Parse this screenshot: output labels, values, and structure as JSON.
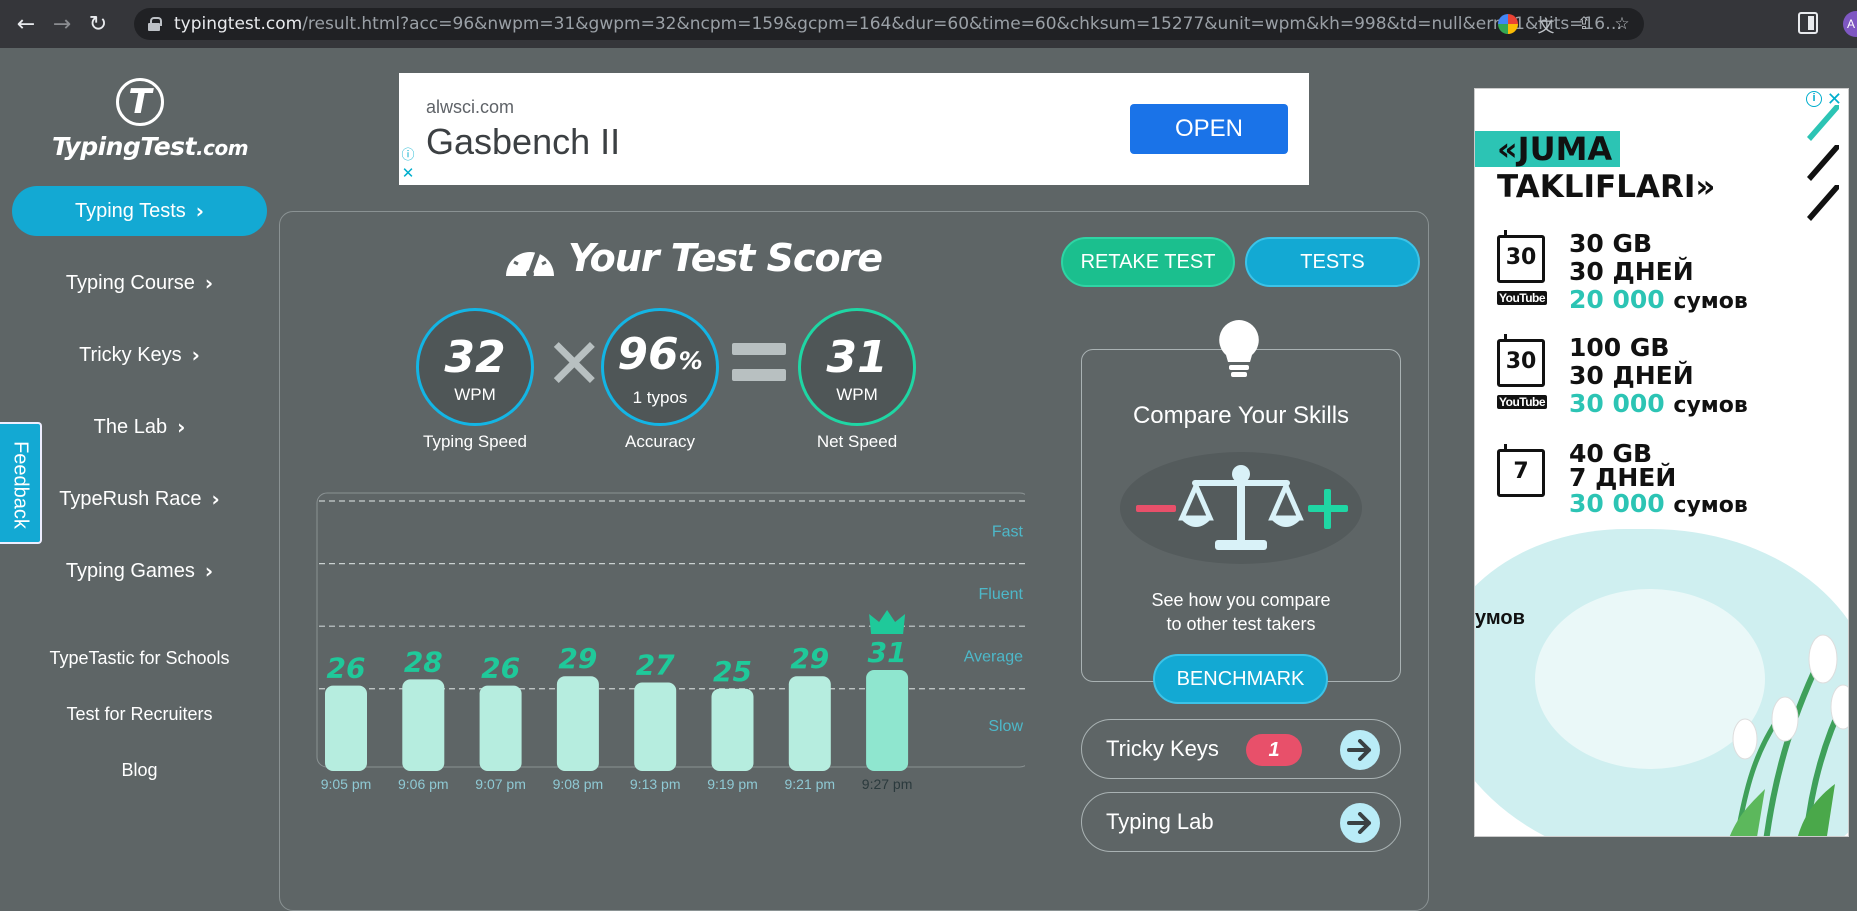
{
  "browser": {
    "url_host": "typingtest.com",
    "url_rest": "/result.html?acc=96&nwpm=31&gwpm=32&ncpm=159&gcpm=164&dur=60&time=60&chksum=15277&unit=wpm&kh=998&td=null&err=1&hits=164&textfile=easyT...",
    "profile_initial": "A"
  },
  "sidebar": {
    "logo_text": "TypingTest",
    "logo_suffix": ".com",
    "items": [
      {
        "label": "Typing Tests"
      },
      {
        "label": "Typing Course"
      },
      {
        "label": "Tricky Keys"
      },
      {
        "label": "The Lab"
      },
      {
        "label": "TypeRush Race"
      },
      {
        "label": "Typing Games"
      }
    ],
    "links": [
      {
        "label": "TypeTastic for Schools"
      },
      {
        "label": "Test for Recruiters"
      },
      {
        "label": "Blog"
      }
    ],
    "feedback": "Feedback"
  },
  "top_ad": {
    "domain": "alwsci.com",
    "headline": "Gasbench II",
    "button": "OPEN"
  },
  "score": {
    "title": "Your Test Score",
    "retake": "RETAKE TEST",
    "tests": "TESTS",
    "speed": {
      "value": "32",
      "unit": "WPM",
      "caption": "Typing Speed"
    },
    "accuracy": {
      "value": "96",
      "suffix": "%",
      "unit": "1  typos",
      "caption": "Accuracy"
    },
    "net": {
      "value": "31",
      "unit": "WPM",
      "caption": "Net Speed"
    }
  },
  "chart_data": {
    "type": "bar",
    "categories": [
      "9:05 pm",
      "9:06 pm",
      "9:07 pm",
      "9:08 pm",
      "9:13 pm",
      "9:19 pm",
      "9:21 pm",
      "9:27 pm"
    ],
    "values": [
      26,
      28,
      26,
      29,
      27,
      25,
      29,
      31
    ],
    "ylim": [
      0,
      85
    ],
    "gridlines": [
      85,
      65,
      45,
      25
    ],
    "zones": [
      "Fast",
      "Fluent",
      "Average",
      "Slow"
    ],
    "highlight_index": 7,
    "colors": {
      "bar": "#b6eddf",
      "bar_highlight": "#8fe6cf",
      "value": "#1fc99a",
      "grid": "#c9d0d0",
      "axis_label": "#8fc9d4",
      "zone": "#4db8c9",
      "latest_tick": "#2b3a3d"
    }
  },
  "compare": {
    "title": "Compare Your Skills",
    "desc_line1": "See how you compare",
    "desc_line2": "to other test takers",
    "benchmark": "BENCHMARK"
  },
  "tricky_keys": {
    "label": "Tricky Keys",
    "badge": "1"
  },
  "typing_lab": {
    "label": "Typing Lab"
  },
  "right_ad": {
    "line1": "«JUMA",
    "line2": "TAKLIFLARI»",
    "offers": [
      {
        "cal": "30",
        "l1": "30 GB",
        "l2": "30 ДНЕЙ",
        "price": "20 000",
        "cur": "сумов",
        "yt": "YouTube"
      },
      {
        "cal": "30",
        "l1": "100 GB",
        "l2": "30 ДНЕЙ",
        "price": "30 000",
        "cur": "сумов",
        "yt": "YouTube"
      },
      {
        "cal": "7",
        "l1": "40 GB",
        "l2": "7 ДНЕЙ",
        "price": "30 000",
        "cur": "сумов",
        "yt": ""
      }
    ],
    "cut_text": "умов"
  }
}
